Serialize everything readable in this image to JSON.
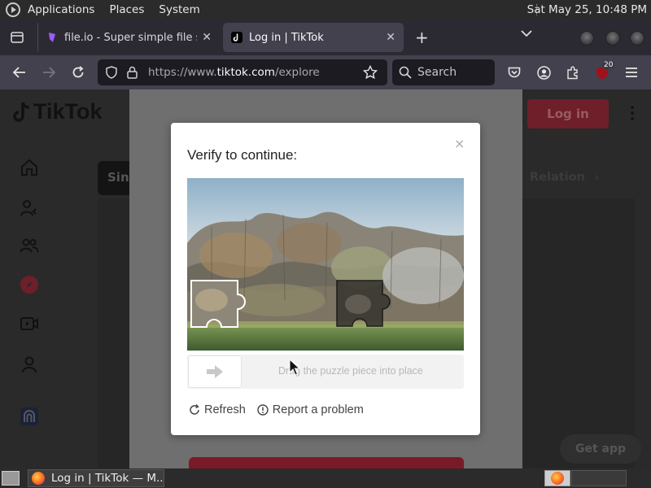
{
  "topbar": {
    "menus": [
      "Applications",
      "Places",
      "System"
    ],
    "clock": "Sat May 25, 10:48 PM"
  },
  "tabs": [
    {
      "title": "file.io - Super simple file sha",
      "close": "✕"
    },
    {
      "title": "Log in | TikTok",
      "close": "✕"
    }
  ],
  "toolbar": {
    "new_tab": "+",
    "url_prefix": "https://www.",
    "url_domain": "tiktok.com",
    "url_path": "/explore",
    "search_placeholder": "Search",
    "extension_badge": "20"
  },
  "tiktok": {
    "logo": "TikTok",
    "login_label": "Log in",
    "pill_label": "Sin",
    "category": "Relation",
    "get_app": "Get app"
  },
  "captcha": {
    "title": "Verify to continue:",
    "close": "×",
    "slider_hint": "Drag the puzzle piece into place",
    "refresh_label": "Refresh",
    "report_label": "Report a problem"
  },
  "taskbar": {
    "window_title": "Log in | TikTok — M..."
  },
  "colors": {
    "tiktok_red": "#fe2c55",
    "firefox_dark": "#2b2a33",
    "toolbar": "#42414d"
  }
}
